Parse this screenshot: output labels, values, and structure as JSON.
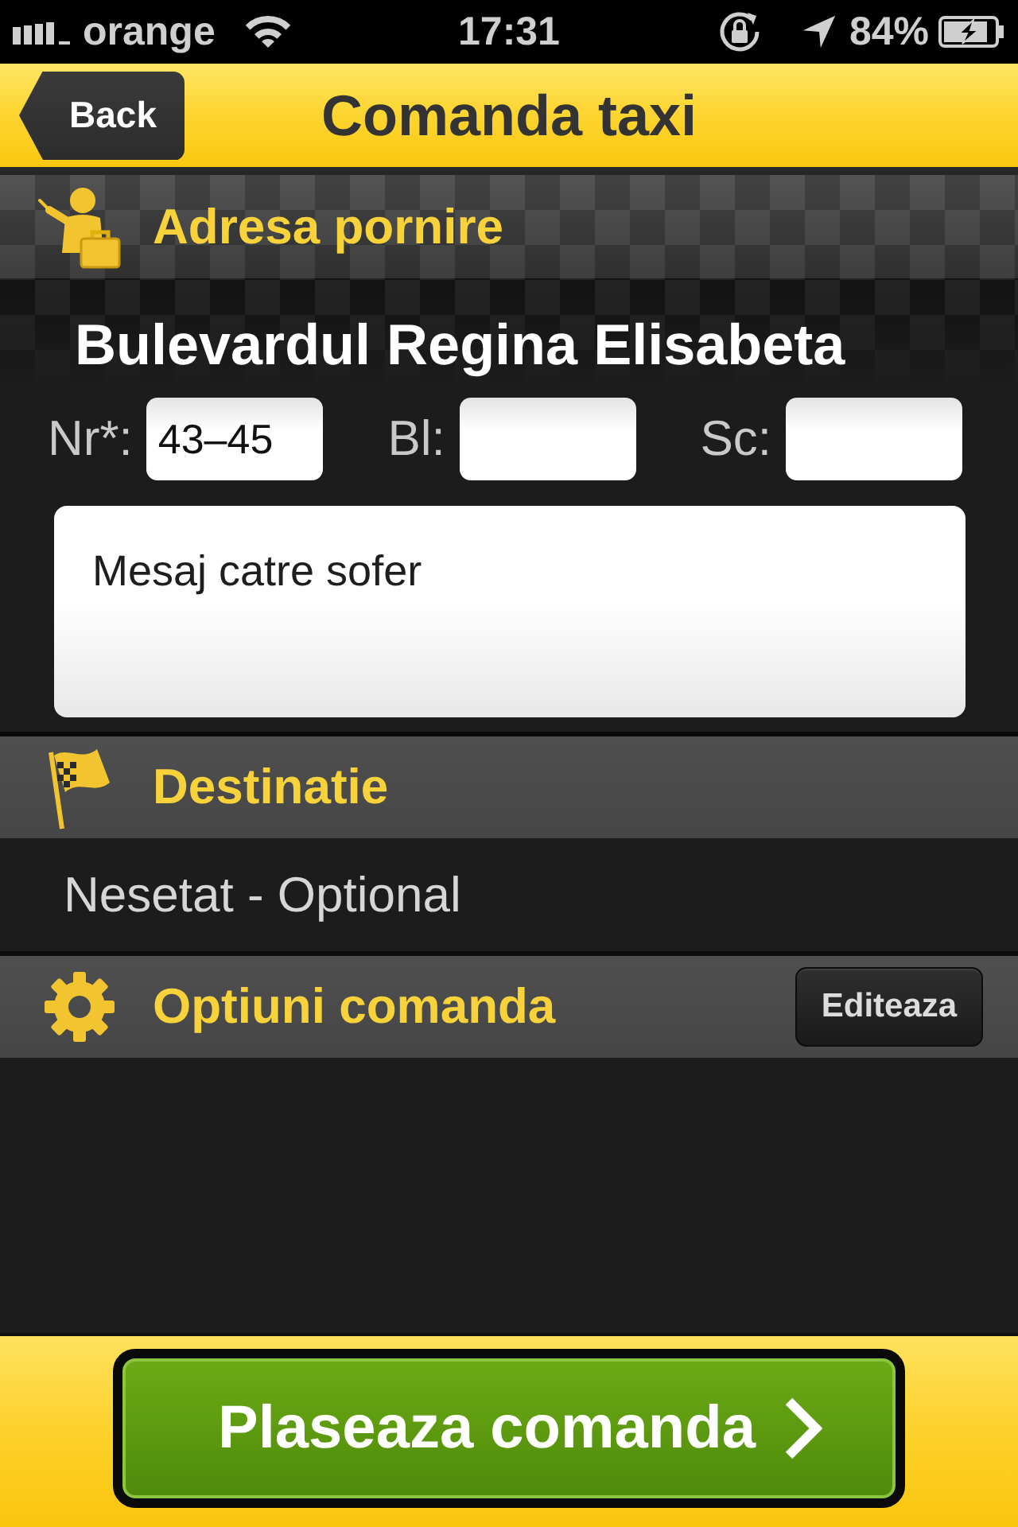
{
  "status_bar": {
    "carrier": "orange",
    "time": "17:31",
    "battery": "84%"
  },
  "nav": {
    "back": "Back",
    "title": "Comanda taxi"
  },
  "sections": [
    {
      "kind": "pickup",
      "title": "Adresa pornire",
      "street": "Bulevardul Regina Elisabeta",
      "fields": [
        {
          "label": "Nr*:",
          "value": "43–45"
        },
        {
          "label": "Bl:"
        },
        {
          "label": "Sc:"
        }
      ],
      "message": {
        "placeholder": "Mesaj catre sofer"
      }
    },
    {
      "kind": "destination",
      "title": "Destinatie",
      "value": "Nesetat - Optional"
    },
    {
      "kind": "options",
      "title": "Optiuni comanda",
      "button": "Editeaza"
    }
  ],
  "action": {
    "label": "Plaseaza comanda"
  }
}
